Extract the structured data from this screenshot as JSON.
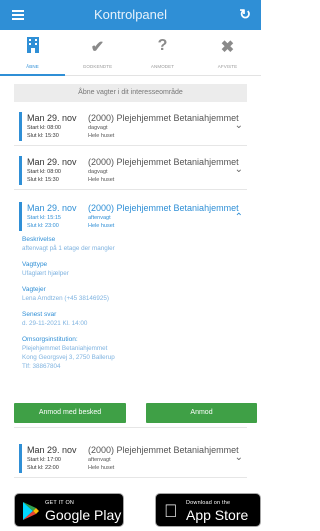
{
  "header": {
    "title": "Kontrolpanel"
  },
  "tabs": [
    {
      "label": "ÅBNE",
      "icon": "building-icon"
    },
    {
      "label": "GODKENDTE",
      "icon": "checkmark-icon"
    },
    {
      "label": "ANMODET",
      "icon": "question-icon"
    },
    {
      "label": "AFVISTE",
      "icon": "cross-icon"
    }
  ],
  "banner": "Åbne vagter i dit interesseområde",
  "shifts": [
    {
      "date": "Man 29. nov",
      "org": "(2000) Plejehjemmet Betaniahjemmet",
      "start": "Start kl: 08:00",
      "slut": "Slut  kl: 15:30",
      "type": "dagvagt",
      "area": "Hele huset"
    },
    {
      "date": "Man 29. nov",
      "org": "(2000) Plejehjemmet Betaniahjemmet",
      "start": "Start kl: 08:00",
      "slut": "Slut  kl: 15:30",
      "type": "dagvagt",
      "area": "Hele huset"
    },
    {
      "date": "Man 29. nov",
      "org": "(2000) Plejehjemmet Betaniahjemmet",
      "start": "Start kl: 15:15",
      "slut": "Slut  kl: 23:00",
      "type": "aftenvagt",
      "area": "Hele huset"
    },
    {
      "date": "Man 29. nov",
      "org": "(2000) Plejehjemmet Betaniahjemmet",
      "start": "Start kl: 17:00",
      "slut": "Slut  kl: 22:00",
      "type": "aftenvagt",
      "area": "Hele huset"
    }
  ],
  "details": {
    "beskrivelse_label": "Beskrivelse",
    "beskrivelse": "aftenvagt på 1 etage der mangler",
    "vagttype_label": "Vagttype",
    "vagttype": "Ufaglært hjælper",
    "vagtejer_label": "Vagtejer",
    "vagtejer": "Lena Arndtzen (+45 38146925)",
    "senest_label": "Senest svar",
    "senest": "d. 29-11-2021 Kl. 14:00",
    "omsorg_label": "Omsorgsinstitution:",
    "omsorg_name": "Plejehjemmet Betaniahjemmet",
    "omsorg_addr": "Kong Georgsvej 3, 2750 Ballerup",
    "omsorg_tlf": "Tlf: 38867804"
  },
  "buttons": {
    "request_with_message": "Anmod med besked",
    "request": "Anmod"
  },
  "stores": {
    "google_small": "GET IT ON",
    "google_big": "Google Play",
    "apple_small": "Download on the",
    "apple_big": "App Store"
  },
  "colors": {
    "primary": "#2f8fd6",
    "accent_green": "#3fa046"
  }
}
